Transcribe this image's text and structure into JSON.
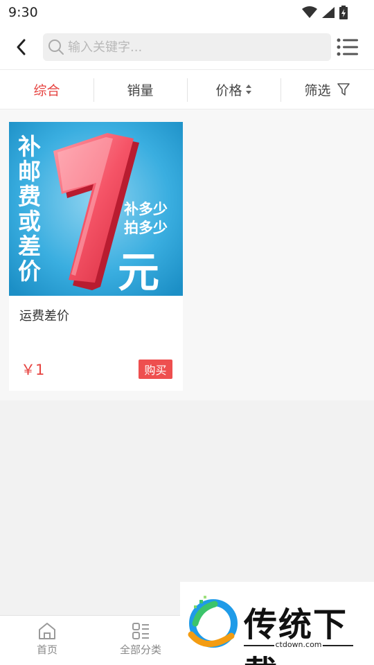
{
  "status_bar": {
    "time": "9:30"
  },
  "search": {
    "placeholder": "输入关键字..."
  },
  "sort_tabs": [
    {
      "label": "综合",
      "active": true
    },
    {
      "label": "销量"
    },
    {
      "label": "价格"
    },
    {
      "label": "筛选"
    }
  ],
  "products": [
    {
      "title": "运费差价",
      "price": "￥1",
      "buy_label": "购买",
      "image": {
        "left_text": "补邮费或差价",
        "big_number": "1",
        "right_text_1": "补多少",
        "right_text_2": "拍多少",
        "unit": "元"
      }
    }
  ],
  "bottom_nav": [
    {
      "label": "首页",
      "icon": "home-icon"
    },
    {
      "label": "全部分类",
      "icon": "category-icon"
    }
  ],
  "watermark": {
    "title": "传统下载",
    "subtitle": "ctdown.com"
  },
  "colors": {
    "accent": "#e64340",
    "buy": "#ee4f4f",
    "banner_blue": "#2ea6d8"
  }
}
